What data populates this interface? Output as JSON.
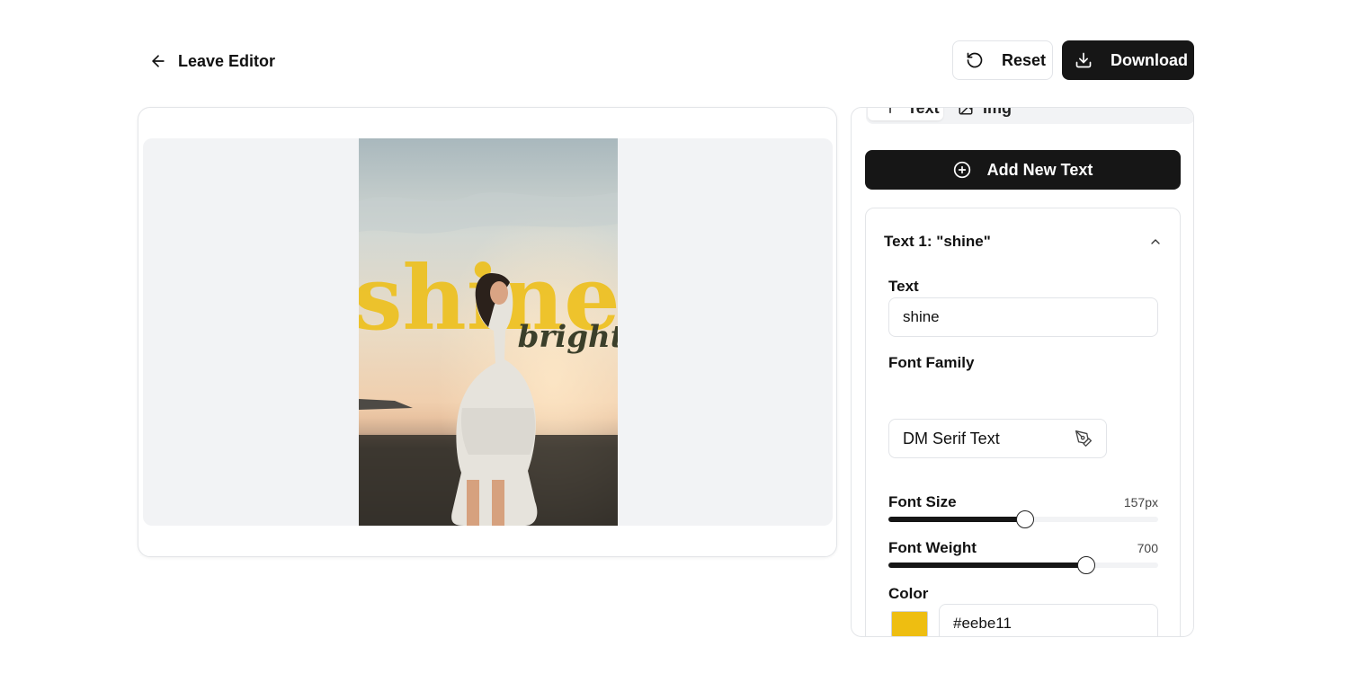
{
  "header": {
    "leave_label": "Leave Editor",
    "reset_label": "Reset",
    "download_label": "Download"
  },
  "canvas": {
    "overlay_title": "shine",
    "overlay_subtitle": "bright",
    "title_color": "#eebe11",
    "subtitle_color": "#3b3f2a"
  },
  "panel": {
    "tabs": [
      {
        "label": "Text",
        "icon": "text-icon",
        "active": true
      },
      {
        "label": "Img",
        "icon": "image-icon",
        "active": false
      }
    ],
    "add_text_label": "Add New Text",
    "layer": {
      "title": "Text 1: \"shine\"",
      "text_label": "Text",
      "text_value": "shine",
      "font_family_label": "Font Family",
      "font_family_value": "DM Serif Text",
      "font_size_label": "Font Size",
      "font_size_display": "157px",
      "font_size_fraction": 0.507,
      "font_weight_label": "Font Weight",
      "font_weight_display": "700",
      "font_weight_fraction": 0.733,
      "color_label": "Color",
      "color_value": "#eebe11"
    }
  }
}
